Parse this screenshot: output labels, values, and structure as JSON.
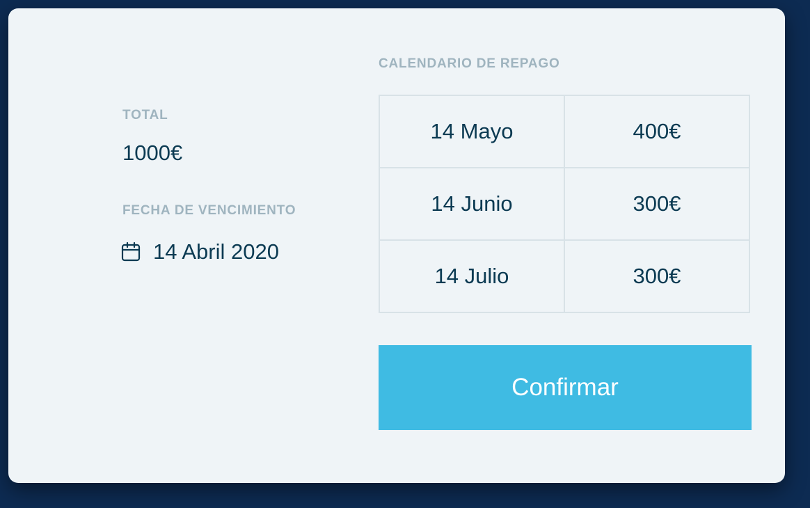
{
  "summary": {
    "total_label": "TOTAL",
    "total_value": "1000€",
    "due_label": "FECHA DE VENCIMIENTO",
    "due_icon": "calendar-icon",
    "due_value": "14 Abril 2020"
  },
  "schedule": {
    "title": "CALENDARIO DE REPAGO",
    "rows": [
      {
        "date": "14 Mayo",
        "amount": "400€"
      },
      {
        "date": "14 Junio",
        "amount": "300€"
      },
      {
        "date": "14 Julio",
        "amount": "300€"
      }
    ]
  },
  "actions": {
    "confirm_label": "Confirmar"
  },
  "colors": {
    "background": "#0d2b52",
    "card": "#eff4f7",
    "accent": "#3fbbe3",
    "text": "#0b3a52",
    "muted": "#9fb4bf"
  }
}
